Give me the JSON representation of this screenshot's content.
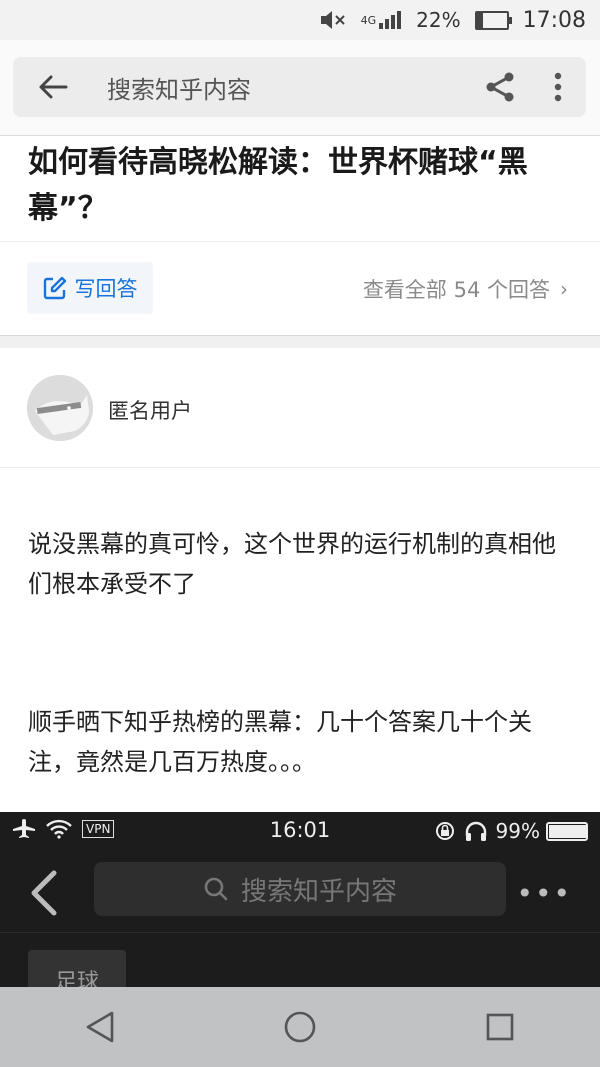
{
  "status_bar": {
    "battery": "22%",
    "battery_level": 0.22,
    "network": "4G",
    "time": "17:08"
  },
  "search": {
    "placeholder": "搜索知乎内容"
  },
  "question": {
    "title": "如何看待高晓松解读：世界杯赌球“黑幕”？"
  },
  "actions": {
    "write_answer": "写回答",
    "view_all": "查看全部 54 个回答"
  },
  "answer": {
    "author": "匿名用户",
    "paragraphs": [
      "说没黑幕的真可怜，这个世界的运行机制的真相他们根本承受不了",
      "顺手晒下知乎热榜的黑幕：几十个答案几十个关注，竟然是几百万热度。。。"
    ]
  },
  "embedded_screenshot": {
    "vpn": "VPN",
    "time": "16:01",
    "battery": "99%",
    "battery_level": 0.99,
    "search_placeholder": "搜索知乎内容",
    "more": "•••",
    "tag": "足球"
  },
  "colors": {
    "accent": "#1a73d9",
    "navbar": "#c0c2c3",
    "embed_bg": "#1c1c1c"
  }
}
